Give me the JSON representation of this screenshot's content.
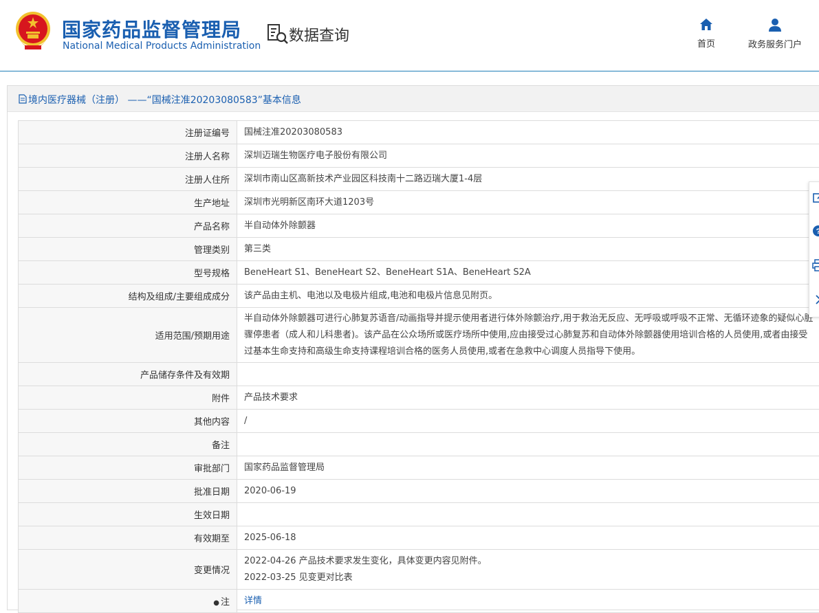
{
  "header": {
    "org_name_cn": "国家药品监督管理局",
    "org_name_en": "National Medical Products Administration",
    "page_label": "数据查询",
    "nav": [
      {
        "label": "首页",
        "icon": "home-icon"
      },
      {
        "label": "政务服务门户",
        "icon": "user-icon"
      }
    ]
  },
  "panel": {
    "title": "境内医疗器械（注册） ——“国械注准20203080583”基本信息",
    "rows": [
      {
        "key": "注册证编号",
        "value": "国械注准20203080583"
      },
      {
        "key": "注册人名称",
        "value": "深圳迈瑞生物医疗电子股份有限公司"
      },
      {
        "key": "注册人住所",
        "value": "深圳市南山区高新技术产业园区科技南十二路迈瑞大厦1-4层"
      },
      {
        "key": "生产地址",
        "value": "深圳市光明新区南环大道1203号"
      },
      {
        "key": "产品名称",
        "value": "半自动体外除颤器"
      },
      {
        "key": "管理类别",
        "value": "第三类"
      },
      {
        "key": "型号规格",
        "value": "BeneHeart S1、BeneHeart S2、BeneHeart S1A、BeneHeart S2A"
      },
      {
        "key": "结构及组成/主要组成成分",
        "value": "该产品由主机、电池以及电极片组成,电池和电极片信息见附页。"
      },
      {
        "key": "适用范围/预期用途",
        "value": "半自动体外除颤器可进行心肺复苏语音/动画指导并提示使用者进行体外除颤治疗,用于救治无反应、无呼吸或呼吸不正常、无循环迹象的疑似心脏骤停患者（成人和儿科患者)。该产品在公众场所或医疗场所中使用,应由接受过心肺复苏和自动体外除颤器使用培训合格的人员使用,或者由接受过基本生命支持和高级生命支持课程培训合格的医务人员使用,或者在急救中心调度人员指导下使用。"
      },
      {
        "key": "产品储存条件及有效期",
        "value": ""
      },
      {
        "key": "附件",
        "value": "产品技术要求"
      },
      {
        "key": "其他内容",
        "value": "/"
      },
      {
        "key": "备注",
        "value": ""
      },
      {
        "key": "审批部门",
        "value": "国家药品监督管理局"
      },
      {
        "key": "批准日期",
        "value": "2020-06-19"
      },
      {
        "key": "生效日期",
        "value": ""
      },
      {
        "key": "有效期至",
        "value": "2025-06-18"
      }
    ],
    "change_label": "变更情况",
    "changes": [
      "2022-04-26 产品技术要求发生变化，具体变更内容见附件。",
      "2022-03-25 见变更对比表"
    ],
    "note_label": "注",
    "note_link": "详情"
  },
  "side_toolbar": [
    "edit-icon",
    "help-icon",
    "print-icon",
    "chevron-right-icon"
  ],
  "colors": {
    "brand": "#1a5fb0",
    "header_line": "#1f7fb8",
    "emblem_red": "#d7161e",
    "emblem_gold": "#f2c12e"
  }
}
